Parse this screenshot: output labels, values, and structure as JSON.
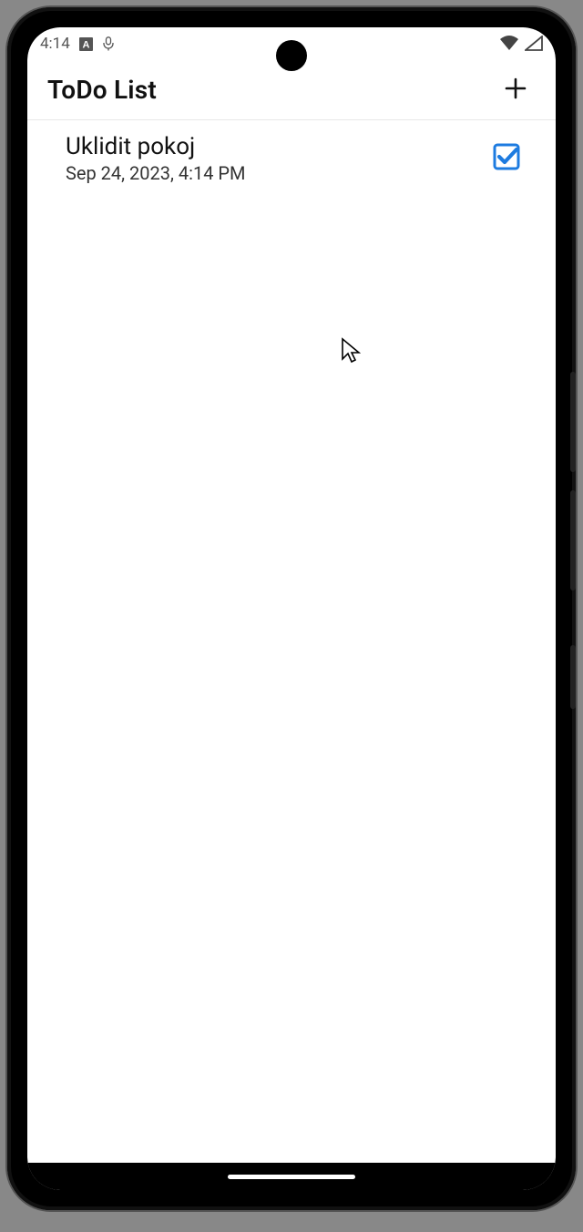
{
  "status": {
    "time": "4:14",
    "icon_a": "A",
    "icon_mic": "mic-icon",
    "wifi": "wifi-icon",
    "signal": "signal-icon"
  },
  "app": {
    "title": "ToDo List",
    "add_icon": "plus-icon"
  },
  "todos": [
    {
      "title": "Uklidit pokoj",
      "date": "Sep 24, 2023, 4:14 PM",
      "checked": true
    }
  ],
  "colors": {
    "accent": "#1d7be0",
    "text": "#111111",
    "subtext": "#333333",
    "divider": "#e8e8e8"
  }
}
